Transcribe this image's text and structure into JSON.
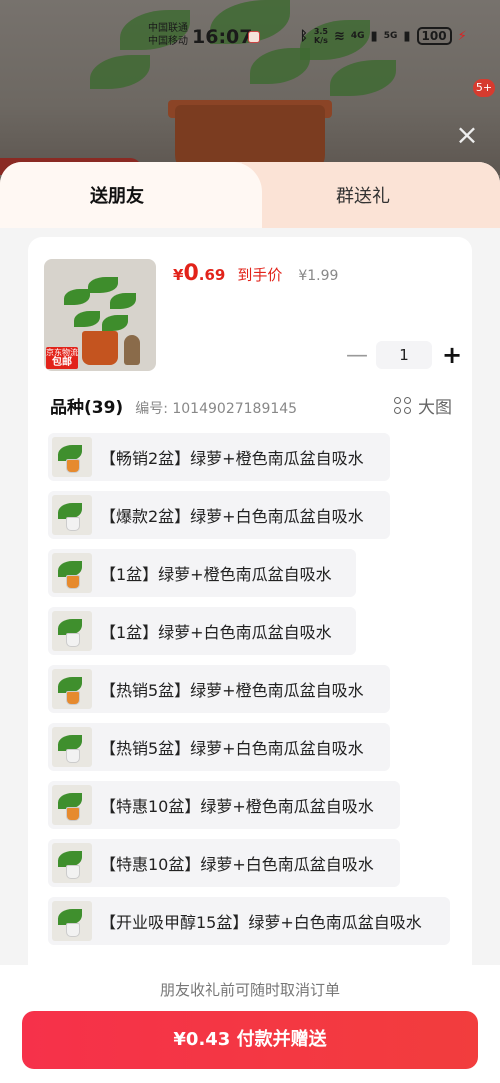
{
  "status_bar": {
    "carrier_1": "中国联通",
    "carrier_2": "中国移动",
    "time": "16:07",
    "speed": "3.5\nK/s",
    "network_1": "4G",
    "network_2": "5G",
    "battery": "100"
  },
  "background": {
    "badge": "5+"
  },
  "tabs": {
    "send_friend": "送朋友",
    "group_gift": "群送礼"
  },
  "product": {
    "price_currency": "¥",
    "price_integer": "0",
    "price_decimal": ".69",
    "price_note": "到手价",
    "original_price": "¥1.99",
    "image_tag_line1": "京东物流",
    "image_tag_line2": "包邮",
    "quantity": "1"
  },
  "variety": {
    "title": "品种(39)",
    "sku": "编号: 10149027189145",
    "big_view": "大图"
  },
  "options": [
    {
      "label": "【畅销2盆】绿萝+橙色南瓜盆自吸水",
      "pot_color": "#e68a2e"
    },
    {
      "label": "【爆款2盆】绿萝+白色南瓜盆自吸水",
      "pot_color": "#f2f2f2"
    },
    {
      "label": "【1盆】绿萝+橙色南瓜盆自吸水",
      "pot_color": "#e68a2e"
    },
    {
      "label": "【1盆】绿萝+白色南瓜盆自吸水",
      "pot_color": "#f2f2f2"
    },
    {
      "label": "【热销5盆】绿萝+橙色南瓜盆自吸水",
      "pot_color": "#e68a2e"
    },
    {
      "label": "【热销5盆】绿萝+白色南瓜盆自吸水",
      "pot_color": "#f2f2f2"
    },
    {
      "label": "【特惠10盆】绿萝+橙色南瓜盆自吸水",
      "pot_color": "#e68a2e"
    },
    {
      "label": "【特惠10盆】绿萝+白色南瓜盆自吸水",
      "pot_color": "#f2f2f2"
    },
    {
      "label": "【开业吸甲醇15盆】绿萝+白色南瓜盆自吸水",
      "pot_color": "#f2f2f2"
    }
  ],
  "footer": {
    "note": "朋友收礼前可随时取消订单",
    "pay_button": "¥0.43 付款并赠送"
  },
  "colors": {
    "accent": "#e2231a",
    "button": "#f23d3d"
  }
}
